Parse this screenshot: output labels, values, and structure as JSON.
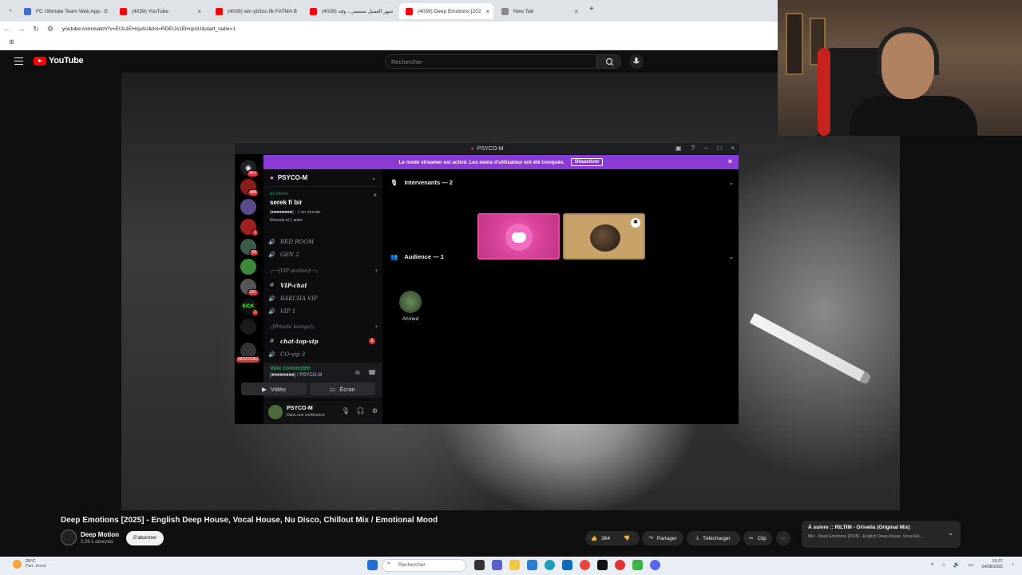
{
  "browser": {
    "tabs": [
      {
        "label": "FC Ultimate Team Web App - E",
        "color": "#3b6fd4"
      },
      {
        "label": "(4039) YouTube",
        "color": "#ff0000"
      },
      {
        "label": "(4039) win yb3ou fik FATMA B",
        "color": "#ff0000"
      },
      {
        "label": "(4039) شهر العسل مستمر... وقد",
        "color": "#ff0000"
      },
      {
        "label": "(4039) Deep Emotions [202",
        "color": "#ff0000"
      },
      {
        "label": "New Tab",
        "color": "#888888"
      }
    ],
    "url": "youtube.com/watch?v=EIJs1EHcpAU&list=RDEIJs1EHcpAU&start_radio=1"
  },
  "youtube": {
    "logo": "YouTube",
    "search_placeholder": "Rechercher",
    "video_title": "Deep Emotions [2025] - English Deep House, Vocal House, Nu Disco, Chillout Mix / Emotional Mood",
    "channel_name": "Deep Motion",
    "channel_subs": "2,06 k abonnés",
    "subscribe": "S'abonner",
    "likes": "364",
    "share": "Partager",
    "download": "Télécharger",
    "clip": "Clip",
    "up_next_title": "À suivre :: RILTIM - Orivella (Original Mix)",
    "up_next_sub": "Mix - Deep Emotions [2025] - English Deep House, Vocal Ho..."
  },
  "discord": {
    "window_title": "PSYCO-M",
    "banner_text": "Le mode streamer est activé. Les noms d'utilisateur ont été tronqués.",
    "banner_button": "Désactiver",
    "server_name": "PSYCO-M",
    "live_tag": "En Direct",
    "live_title": "serek fi bir",
    "live_row": "[■■■■■■■■] · 1 en écoute",
    "live_row2": "Khaoula et 1 autre",
    "channels": {
      "red_room": "RED ROOM",
      "gen2": "GEN 2",
      "vip_section": "┌──[VIP section]──┐",
      "vip_chat": "VIP-chat",
      "rakcha_vip": "RAKCHA VIP",
      "vip1": "VIP 1",
      "private_lounge": "┌[Private lounge]┐",
      "chat_top_vip": "chat-top-vip",
      "chat_top_vip_unread": "1",
      "co_vip3": "CO-vip 3"
    },
    "server_badges": [
      "1K+",
      "488",
      "1",
      "59",
      "291",
      "3",
      "NOUVEAU"
    ],
    "voice_status": "Voix connectée",
    "voice_sub": "[■■■■■■■■] / PSYCO-M",
    "video_btn": "Vidéo",
    "screen_btn": "Écran",
    "user_name": "PSYCO-M",
    "user_status": "Dans une conférence",
    "speakers_header": "Intervenants — 2",
    "audience_header": "Audience — 1",
    "audience_member": "Ahmed"
  },
  "taskbar": {
    "temp": "25°C",
    "weather": "Parc. Ensol",
    "search": "Rechercher",
    "time": "15:37",
    "date": "24/08/2025"
  }
}
